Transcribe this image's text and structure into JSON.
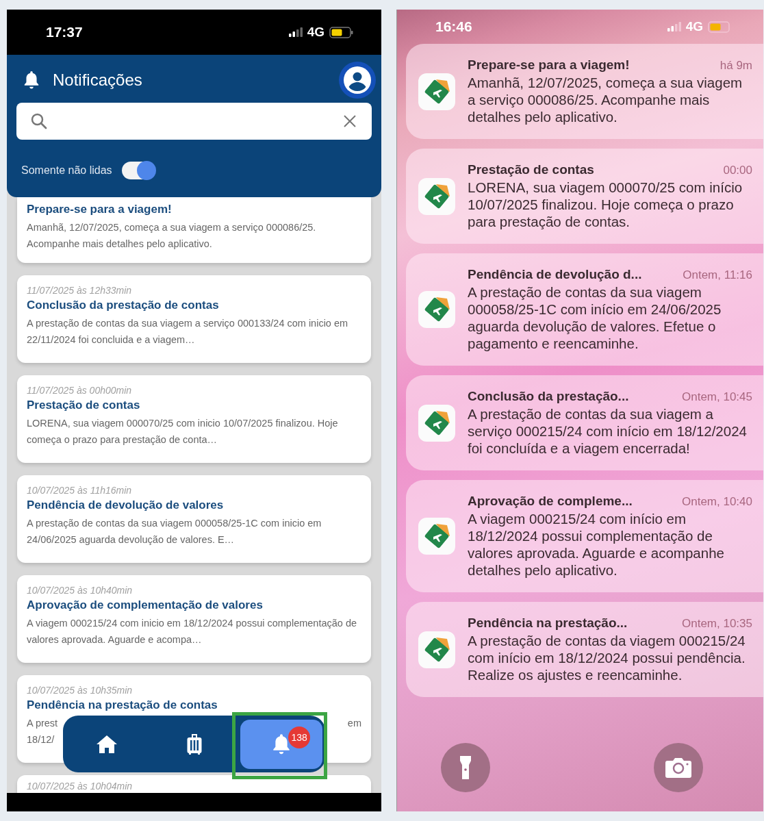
{
  "left_screen": {
    "status_bar": {
      "time": "17:37",
      "network": "4G"
    },
    "header": {
      "title": "Notificações"
    },
    "filter": {
      "label": "Somente não lidas",
      "on": true
    },
    "notifications": [
      {
        "title": "Prepare-se para a viagem!",
        "body": "Amanhã, 12/07/2025, começa a sua viagem a serviço 000086/25. Acompanhe mais detalhes pelo aplicativo."
      },
      {
        "date": "11/07/2025 às 12h33min",
        "title": "Conclusão da prestação de contas",
        "body": "A prestação de contas da sua viagem a serviço 000133/24 com inicio em 22/11/2024 foi concluida e a viagem…"
      },
      {
        "date": "11/07/2025 às 00h00min",
        "title": "Prestação de contas",
        "body": "LORENA, sua viagem 000070/25 com inicio 10/07/2025 finalizou. Hoje começa o prazo para prestação de conta…"
      },
      {
        "date": "10/07/2025 às 11h16min",
        "title": "Pendência de devolução de valores",
        "body": "A prestação de contas da sua viagem 000058/25-1C com inicio em 24/06/2025 aguarda devolução de valores. E…"
      },
      {
        "date": "10/07/2025 às 10h40min",
        "title": "Aprovação de complementação de valores",
        "body": "A viagem 000215/24  com inicio em 18/12/2024  possui complementação de valores aprovada. Aguarde e acompa…"
      },
      {
        "date": "10/07/2025 às 10h35min",
        "title": "Pendência na prestação de contas",
        "body_parts": [
          "A prest",
          "em",
          "18/12/"
        ]
      },
      {
        "date": "10/07/2025 às 10h04min"
      }
    ],
    "nav": [
      {
        "kind": "home",
        "selected": false
      },
      {
        "kind": "luggage",
        "selected": false
      },
      {
        "kind": "bell",
        "selected": true,
        "badge": "138",
        "highlighted": true
      }
    ]
  },
  "right_screen": {
    "status_bar": {
      "time": "16:46",
      "network": "4G"
    },
    "notifications": [
      {
        "title": "Prepare-se para a viagem!",
        "time": "há 9m",
        "body": "Amanhã, 12/07/2025, começa a sua viagem a serviço 000086/25. Acompanhe mais detalhes pelo aplicativo."
      },
      {
        "title": "Prestação de contas",
        "time": "00:00",
        "body": "LORENA, sua viagem 000070/25 com início 10/07/2025 finalizou. Hoje começa o prazo para prestação de contas."
      },
      {
        "title": "Pendência de devolução d...",
        "time": "Ontem, 11:16",
        "body": "A prestação de contas da sua viagem 000058/25-1C com início em 24/06/2025 aguarda devolução de valores. Efetue o pagamento e reencaminhe."
      },
      {
        "title": "Conclusão da prestação...",
        "time": "Ontem, 10:45",
        "body": "A prestação de contas da sua viagem a serviço 000215/24 com início em 18/12/2024 foi concluída e a viagem encerrada!"
      },
      {
        "title": "Aprovação de compleme...",
        "time": "Ontem, 10:40",
        "body": "A viagem 000215/24  com início em 18/12/2024  possui complementação de valores aprovada. Aguarde e acompanhe detalhes pelo aplicativo."
      },
      {
        "title": "Pendência na prestação...",
        "time": "Ontem, 10:35",
        "body": "A prestação de contas da viagem 000215/24 com início em 18/12/2024 possui pendência. Realize os ajustes e reencaminhe."
      }
    ]
  }
}
